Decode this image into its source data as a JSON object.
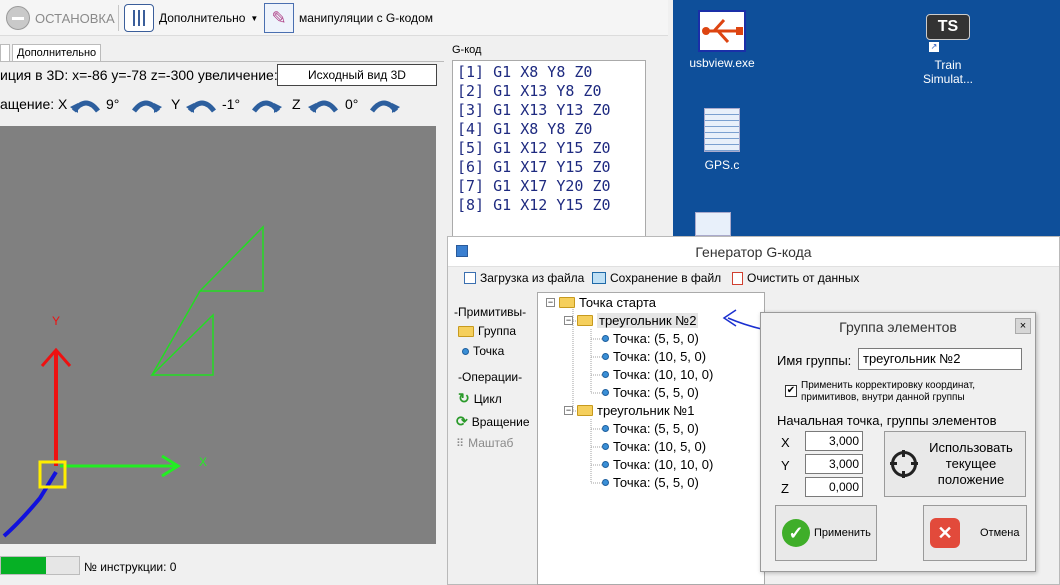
{
  "toolbar": {
    "stop_label": "ОСТАНОВКА",
    "extra_label": "Дополнительно",
    "gcode_manip_label": "манипуляции с G-кодом"
  },
  "tabs": {
    "extra_tab": "Дополнительно"
  },
  "view3d": {
    "position_text": "иция в 3D: x=-86 y=-78 z=-300 увеличение:",
    "reset_button": "Исходный вид 3D",
    "rotation_label": "ащение: X",
    "x_angle": "9°",
    "y_label": "Y",
    "y_angle": "-1°",
    "z_label": "Z",
    "z_angle": "0°",
    "axis_x": "X",
    "axis_y": "Y"
  },
  "status": {
    "progress_fraction": 0.58,
    "instruction_label": "№ инструкции: 0"
  },
  "gcode": {
    "title": "G-код",
    "lines": [
      "[1] G1 X8 Y8 Z0",
      "[2] G1 X13 Y8 Z0",
      "[3] G1 X13 Y13 Z0",
      "[4] G1 X8 Y8 Z0",
      "[5] G1 X12 Y15 Z0",
      "[6] G1 X17 Y15 Z0",
      "[7] G1 X17 Y20 Z0",
      "[8] G1 X12 Y15 Z0"
    ]
  },
  "desktop": {
    "icons": [
      {
        "label": "usbview.exe",
        "icon": "usb-app-icon"
      },
      {
        "label": "Train Simulat...",
        "icon": "ts-app-icon"
      },
      {
        "label": "GPS.c",
        "icon": "text-file-icon"
      }
    ]
  },
  "generator": {
    "title": "Генератор G-кода",
    "load_label": "Загрузка из файла",
    "save_label": "Сохранение в файл",
    "clear_label": "Очистить от данных",
    "primitives_header": "-Примитивы-",
    "group_label": "Группа",
    "point_label": "Точка",
    "operations_header": "-Операции-",
    "loop_label": "Цикл",
    "rotate_label": "Вращение",
    "scale_label": "Маштаб",
    "tree": {
      "root": "Точка старта",
      "groups": [
        {
          "name": "треугольник №2",
          "points": [
            "Точка: (5, 5, 0)",
            "Точка: (10, 5, 0)",
            "Точка: (10, 10, 0)",
            "Точка: (5, 5, 0)"
          ]
        },
        {
          "name": "треугольник №1",
          "points": [
            "Точка: (5, 5, 0)",
            "Точка: (10, 5, 0)",
            "Точка: (10, 10, 0)",
            "Точка: (5, 5, 0)"
          ]
        }
      ]
    }
  },
  "group_dialog": {
    "title": "Группа элементов",
    "name_label": "Имя группы:",
    "name_value": "треугольник №2",
    "checkbox_label_1": "Применить корректировку координат,",
    "checkbox_label_2": "примитивов, внутри данной группы",
    "start_point_label": "Начальная точка, группы элементов",
    "x_label": "X",
    "x_value": "3,000",
    "y_label": "Y",
    "y_value": "3,000",
    "z_label": "Z",
    "z_value": "0,000",
    "use_current_1": "Использовать",
    "use_current_2": "текущее",
    "use_current_3": "положение",
    "apply_label": "Применить",
    "cancel_label": "Отмена"
  }
}
